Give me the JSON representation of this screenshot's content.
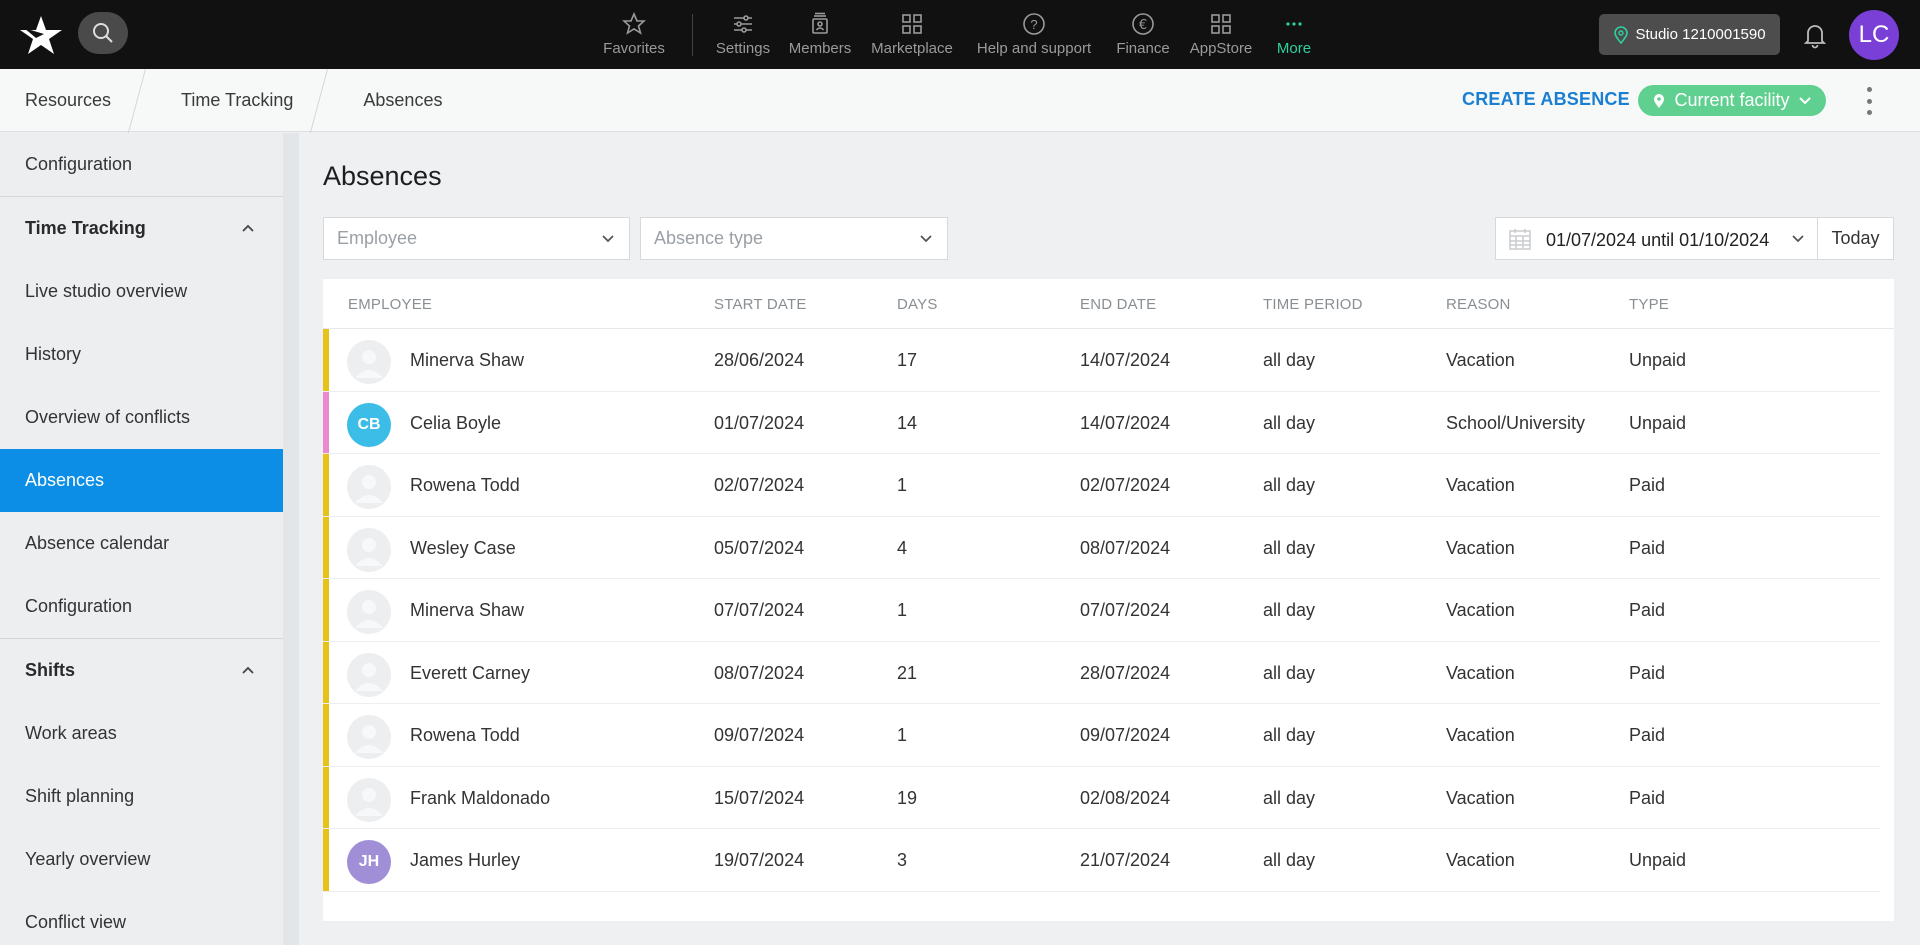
{
  "topbar": {
    "nav": [
      {
        "label": "Favorites",
        "icon": "star-icon"
      },
      {
        "label": "Settings",
        "icon": "sliders-icon"
      },
      {
        "label": "Members",
        "icon": "members-icon"
      },
      {
        "label": "Marketplace",
        "icon": "grid-icon"
      },
      {
        "label": "Help and support",
        "icon": "help-icon"
      },
      {
        "label": "Finance",
        "icon": "euro-icon"
      },
      {
        "label": "AppStore",
        "icon": "apps-icon"
      },
      {
        "label": "More",
        "icon": "more-icon"
      }
    ],
    "studio_label": "Studio 1210001590",
    "user_initials": "LC",
    "accent": "#2ecf9e"
  },
  "breadcrumb": [
    "Resources",
    "Time Tracking",
    "Absences"
  ],
  "actions": {
    "create_absence": "CREATE ABSENCE",
    "facility": "Current facility"
  },
  "sidebar": {
    "items": [
      {
        "label": "Configuration",
        "type": "item"
      },
      {
        "label": "Time Tracking",
        "type": "header"
      },
      {
        "label": "Live studio overview",
        "type": "item"
      },
      {
        "label": "History",
        "type": "item"
      },
      {
        "label": "Overview of conflicts",
        "type": "item"
      },
      {
        "label": "Absences",
        "type": "active"
      },
      {
        "label": "Absence calendar",
        "type": "item"
      },
      {
        "label": "Configuration",
        "type": "item"
      },
      {
        "label": "Shifts",
        "type": "header"
      },
      {
        "label": "Work areas",
        "type": "item"
      },
      {
        "label": "Shift planning",
        "type": "item"
      },
      {
        "label": "Yearly overview",
        "type": "item"
      },
      {
        "label": "Conflict view",
        "type": "item"
      }
    ]
  },
  "page": {
    "title": "Absences",
    "filters": {
      "employee_placeholder": "Employee",
      "absence_type_placeholder": "Absence type",
      "date_range": "01/07/2024 until 01/10/2024",
      "today": "Today"
    }
  },
  "table": {
    "columns": [
      "EMPLOYEE",
      "START DATE",
      "DAYS",
      "END DATE",
      "TIME PERIOD",
      "REASON",
      "TYPE"
    ],
    "rows": [
      {
        "name": "Minerva Shaw",
        "initials": "",
        "avatar_color": "",
        "bar_color": "#e8c21a",
        "start": "28/06/2024",
        "days": "17",
        "end": "14/07/2024",
        "period": "all day",
        "reason": "Vacation",
        "type": "Unpaid"
      },
      {
        "name": "Celia Boyle",
        "initials": "CB",
        "avatar_color": "#3bbde8",
        "bar_color": "#e98ad0",
        "start": "01/07/2024",
        "days": "14",
        "end": "14/07/2024",
        "period": "all day",
        "reason": "School/University",
        "type": "Unpaid"
      },
      {
        "name": "Rowena Todd",
        "initials": "",
        "avatar_color": "",
        "bar_color": "#e8c21a",
        "start": "02/07/2024",
        "days": "1",
        "end": "02/07/2024",
        "period": "all day",
        "reason": "Vacation",
        "type": "Paid"
      },
      {
        "name": "Wesley Case",
        "initials": "",
        "avatar_color": "",
        "bar_color": "#e8c21a",
        "start": "05/07/2024",
        "days": "4",
        "end": "08/07/2024",
        "period": "all day",
        "reason": "Vacation",
        "type": "Paid"
      },
      {
        "name": "Minerva Shaw",
        "initials": "",
        "avatar_color": "",
        "bar_color": "#e8c21a",
        "start": "07/07/2024",
        "days": "1",
        "end": "07/07/2024",
        "period": "all day",
        "reason": "Vacation",
        "type": "Paid"
      },
      {
        "name": "Everett Carney",
        "initials": "",
        "avatar_color": "",
        "bar_color": "#e8c21a",
        "start": "08/07/2024",
        "days": "21",
        "end": "28/07/2024",
        "period": "all day",
        "reason": "Vacation",
        "type": "Paid"
      },
      {
        "name": "Rowena Todd",
        "initials": "",
        "avatar_color": "",
        "bar_color": "#e8c21a",
        "start": "09/07/2024",
        "days": "1",
        "end": "09/07/2024",
        "period": "all day",
        "reason": "Vacation",
        "type": "Paid"
      },
      {
        "name": "Frank Maldonado",
        "initials": "",
        "avatar_color": "",
        "bar_color": "#e8c21a",
        "start": "15/07/2024",
        "days": "19",
        "end": "02/08/2024",
        "period": "all day",
        "reason": "Vacation",
        "type": "Paid"
      },
      {
        "name": "James Hurley",
        "initials": "JH",
        "avatar_color": "#a08fd6",
        "bar_color": "#e8c21a",
        "start": "19/07/2024",
        "days": "3",
        "end": "21/07/2024",
        "period": "all day",
        "reason": "Vacation",
        "type": "Unpaid"
      }
    ]
  }
}
